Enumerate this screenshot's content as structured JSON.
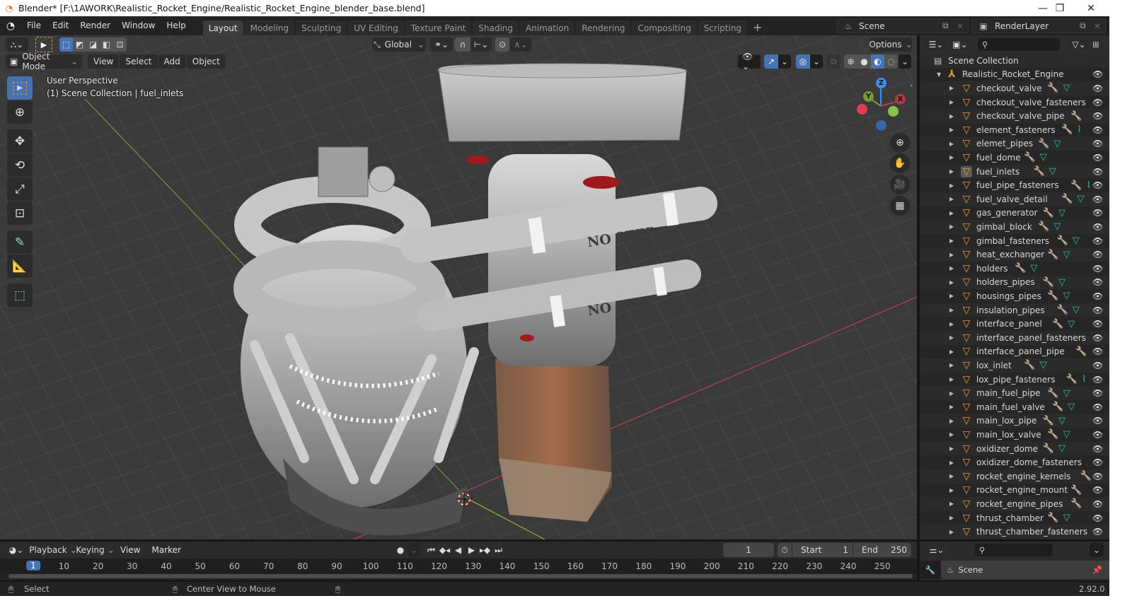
{
  "window": {
    "title": "Blender* [F:\\1AWORK\\Realistic_Rocket_Engine/Realistic_Rocket_Engine_blender_base.blend]",
    "controls": {
      "minimize": "—",
      "maximize": "❐",
      "close": "✕"
    }
  },
  "menubar": {
    "items": [
      "File",
      "Edit",
      "Render",
      "Window",
      "Help"
    ],
    "workspace_tabs": [
      "Layout",
      "Modeling",
      "Sculpting",
      "UV Editing",
      "Texture Paint",
      "Shading",
      "Animation",
      "Rendering",
      "Compositing",
      "Scripting"
    ],
    "active_tab": "Layout",
    "add_tab": "+",
    "scene": "Scene",
    "view_layer": "RenderLayer"
  },
  "viewport": {
    "mode": "Object Mode",
    "menus": [
      "View",
      "Select",
      "Add",
      "Object"
    ],
    "transform_orientation": "Global",
    "options_label": "Options",
    "overlay_text_line1": "User Perspective",
    "overlay_text_line2": "(1) Scene Collection | fuel_inlets",
    "stencil_text": "NO STEP",
    "gizmo_axes": {
      "x": "X",
      "y": "Y",
      "z": "Z"
    },
    "colors": {
      "x_axis": "#e03e52",
      "y_axis": "#8bc34a",
      "z_axis": "#3b8ff0",
      "active_tool": "#4772b3"
    },
    "tools": [
      "select-box",
      "cursor",
      "move",
      "rotate",
      "scale",
      "transform",
      "annotate",
      "measure",
      "add-cube"
    ],
    "nav_buttons": [
      "zoom",
      "pan",
      "camera",
      "ortho"
    ]
  },
  "outliner": {
    "root": "Scene Collection",
    "collection": "Realistic_Rocket_Engine",
    "items": [
      {
        "name": "checkout_valve",
        "mod": true,
        "data": "mesh"
      },
      {
        "name": "checkout_valve_fasteners",
        "mod": false,
        "data": "none"
      },
      {
        "name": "checkout_valve_pipe",
        "mod": true,
        "data": "none"
      },
      {
        "name": "element_fasteners",
        "mod": true,
        "data": "curve"
      },
      {
        "name": "elemet_pipes",
        "mod": true,
        "data": "mesh"
      },
      {
        "name": "fuel_dome",
        "mod": true,
        "data": "mesh"
      },
      {
        "name": "fuel_inlets",
        "mod": true,
        "data": "mesh",
        "selected": true
      },
      {
        "name": "fuel_pipe_fasteners",
        "mod": true,
        "data": "curve"
      },
      {
        "name": "fuel_valve_detail",
        "mod": true,
        "data": "mesh"
      },
      {
        "name": "gas_generator",
        "mod": true,
        "data": "mesh"
      },
      {
        "name": "gimbal_block",
        "mod": true,
        "data": "mesh"
      },
      {
        "name": "gimbal_fasteners",
        "mod": true,
        "data": "mesh"
      },
      {
        "name": "heat_exchanger",
        "mod": true,
        "data": "mesh"
      },
      {
        "name": "holders",
        "mod": true,
        "data": "mesh"
      },
      {
        "name": "holders_pipes",
        "mod": true,
        "data": "mesh"
      },
      {
        "name": "housings_pipes",
        "mod": true,
        "data": "mesh"
      },
      {
        "name": "insulation_pipes",
        "mod": true,
        "data": "mesh"
      },
      {
        "name": "interface_panel",
        "mod": true,
        "data": "mesh"
      },
      {
        "name": "interface_panel_fasteners",
        "mod": false,
        "data": "none"
      },
      {
        "name": "interface_panel_pipe",
        "mod": true,
        "data": "none"
      },
      {
        "name": "lox_inlet",
        "mod": true,
        "data": "mesh"
      },
      {
        "name": "lox_pipe_fasteners",
        "mod": true,
        "data": "curve"
      },
      {
        "name": "main_fuel_pipe",
        "mod": true,
        "data": "mesh"
      },
      {
        "name": "main_fuel_valve",
        "mod": true,
        "data": "mesh"
      },
      {
        "name": "main_lox_pipe",
        "mod": true,
        "data": "mesh"
      },
      {
        "name": "main_lox_valve",
        "mod": true,
        "data": "mesh"
      },
      {
        "name": "oxidizer_dome",
        "mod": true,
        "data": "mesh"
      },
      {
        "name": "oxidizer_dome_fasteners",
        "mod": false,
        "data": "none"
      },
      {
        "name": "rocket_engine_kernels",
        "mod": true,
        "data": "none"
      },
      {
        "name": "rocket_engine_mount",
        "mod": true,
        "data": "none"
      },
      {
        "name": "rocket_engine_pipes",
        "mod": true,
        "data": "none"
      },
      {
        "name": "thrust_chamber",
        "mod": true,
        "data": "mesh"
      },
      {
        "name": "thrust_chamber_fasteners",
        "mod": false,
        "data": "none"
      }
    ],
    "colors": {
      "mesh_icon": "#e8963c",
      "modifier_icon": "#6b8ed6",
      "data_icon": "#2ec48a"
    }
  },
  "timeline": {
    "menus": [
      "Playback",
      "Keying",
      "View",
      "Marker"
    ],
    "current_frame": "1",
    "start_label": "Start",
    "start": "1",
    "end_label": "End",
    "end": "250",
    "ticks": [
      "1",
      "10",
      "20",
      "30",
      "40",
      "50",
      "60",
      "70",
      "80",
      "90",
      "100",
      "110",
      "120",
      "130",
      "140",
      "150",
      "160",
      "170",
      "180",
      "190",
      "200",
      "210",
      "220",
      "230",
      "240",
      "250"
    ]
  },
  "properties": {
    "context": "Scene"
  },
  "statusbar": {
    "left_action": "Select",
    "middle_action": "Center View to Mouse",
    "version": "2.92.0"
  }
}
